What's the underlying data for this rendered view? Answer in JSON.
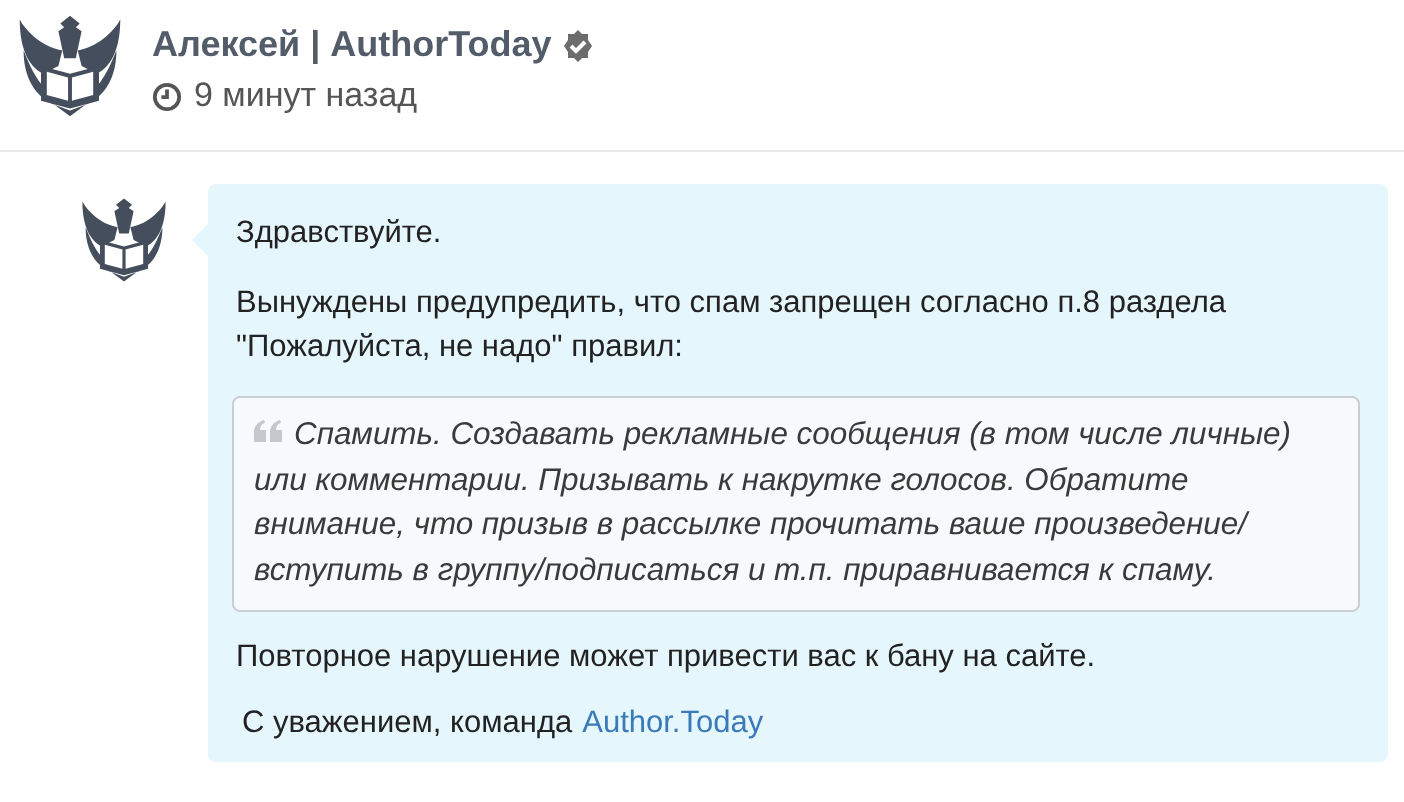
{
  "post": {
    "author": "Алексей | AuthorToday",
    "verified": true,
    "time": "9 минут назад"
  },
  "message": {
    "greeting": "Здравствуйте.",
    "warning": "Вынуждены предупредить, что спам запрещен согласно п.8 раздела \"Пожалуйста, не надо\" правил:",
    "quote": "Спамить. Создавать рекламные сообщения (в том числе личные) или комментарии. Призывать к накрутке голосов. Обратите внимание, что призыв в рассылке прочитать ваше произведение/вступить в группу/подписаться и т.п. приравнивается к спаму.",
    "consequence": "Повторное нарушение может привести вас к бану на сайте.",
    "signature": "С уважением, команда",
    "link": "Author.Today"
  }
}
